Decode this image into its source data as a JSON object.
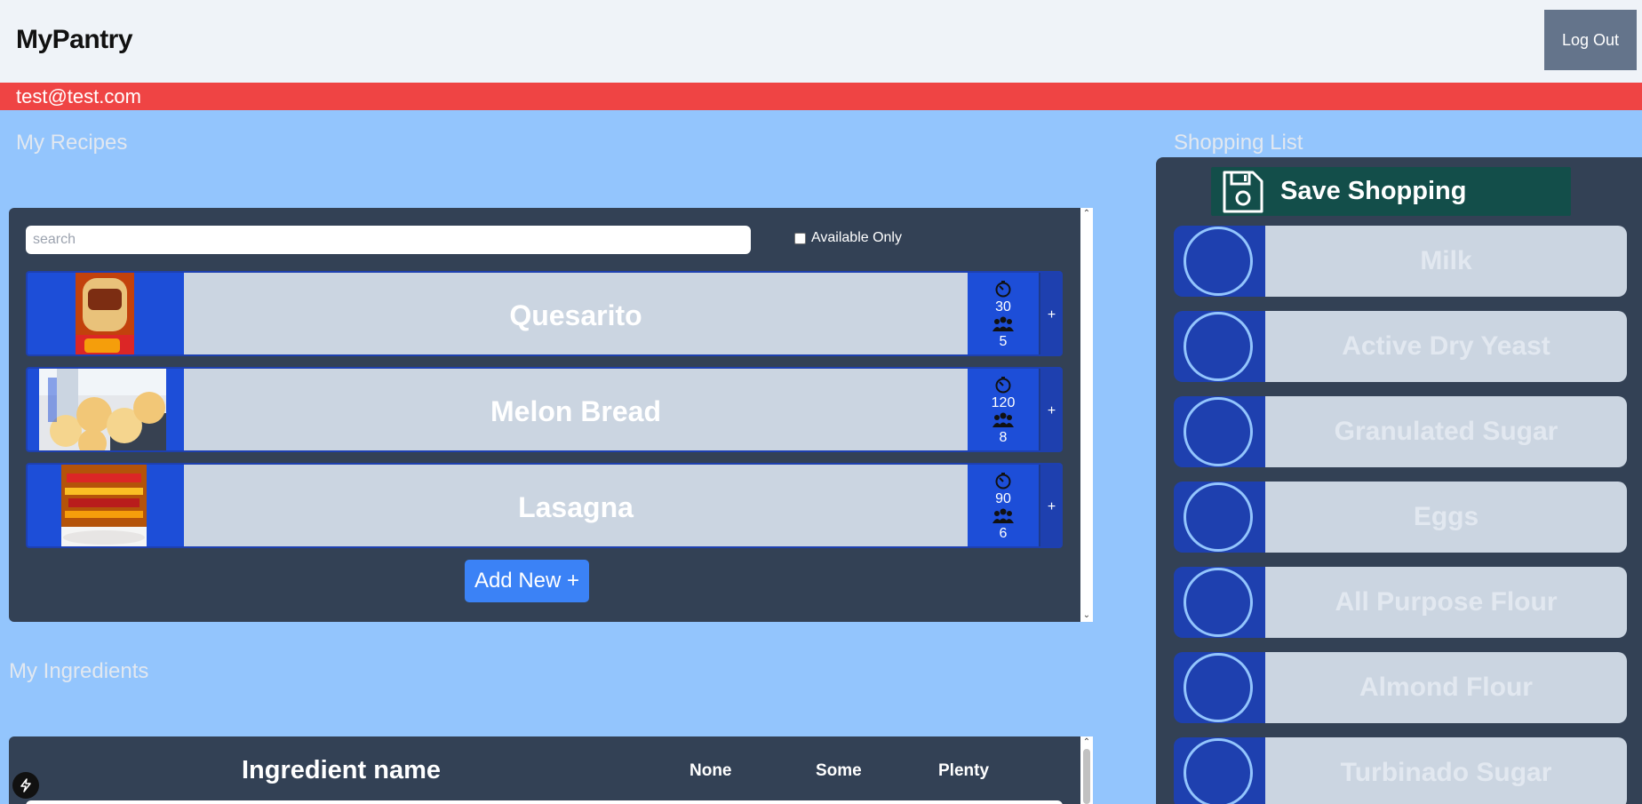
{
  "header": {
    "brand": "MyPantry",
    "logout_label": "Log Out"
  },
  "user": {
    "email": "test@test.com"
  },
  "recipes": {
    "title": "My Recipes",
    "search_placeholder": "search",
    "available_only_label": "Available Only",
    "items": [
      {
        "name": "Quesarito",
        "time": "30",
        "servings": "5",
        "add_label": "+"
      },
      {
        "name": "Melon Bread",
        "time": "120",
        "servings": "8",
        "add_label": "+"
      },
      {
        "name": "Lasagna",
        "time": "90",
        "servings": "6",
        "add_label": "+"
      }
    ],
    "add_new_label": "Add New +"
  },
  "ingredients": {
    "title": "My Ingredients",
    "columns": {
      "name": "Ingredient name",
      "none": "None",
      "some": "Some",
      "plenty": "Plenty"
    }
  },
  "shopping": {
    "title": "Shopping List",
    "save_label": "Save Shopping",
    "items": [
      "Milk",
      "Active Dry Yeast",
      "Granulated Sugar",
      "Eggs",
      "All Purpose Flour",
      "Almond Flour",
      "Turbinado Sugar"
    ]
  },
  "colors": {
    "accent_blue": "#1d4ed8",
    "user_bar": "#ef4444",
    "page_bg": "#93c5fd",
    "panel": "#334155",
    "save_button": "#134e4a"
  }
}
